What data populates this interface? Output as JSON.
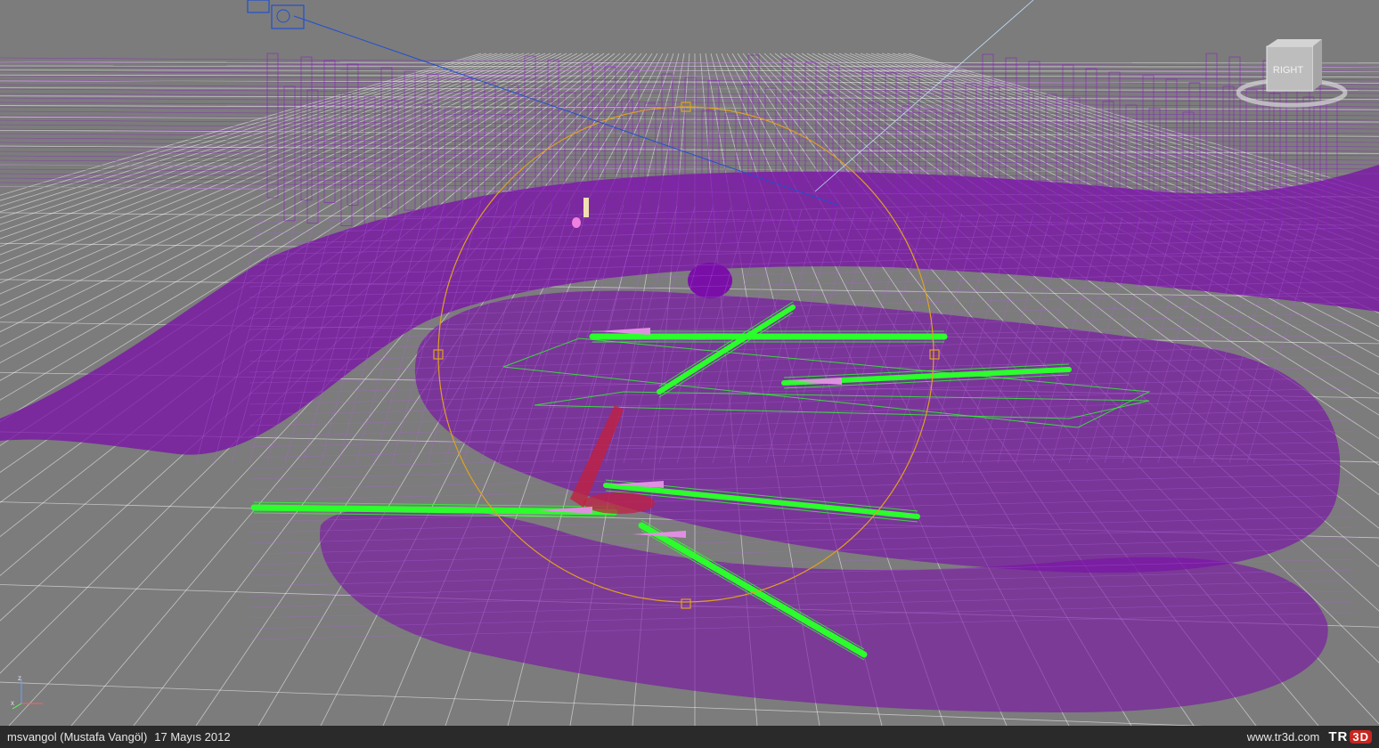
{
  "viewport": {
    "background": "#7c7c7c",
    "grid_color": "#ffffff",
    "terrain_color": "#7a0fa8",
    "selection_color": "#2bff2b",
    "gizmo_color": "#e0a020",
    "camera_line_color": "#2050d0"
  },
  "viewcube": {
    "face_label": "RIGHT",
    "icon": "viewcube-icon"
  },
  "axis_tripod": {
    "z_label": "z",
    "x_label": "x"
  },
  "status_bar": {
    "author": "msvangol (Mustafa Vangöl)",
    "date": "17 Mayıs 2012",
    "website": "www.tr3d.com",
    "logo_text": "TR",
    "logo_box_text": "3D"
  }
}
